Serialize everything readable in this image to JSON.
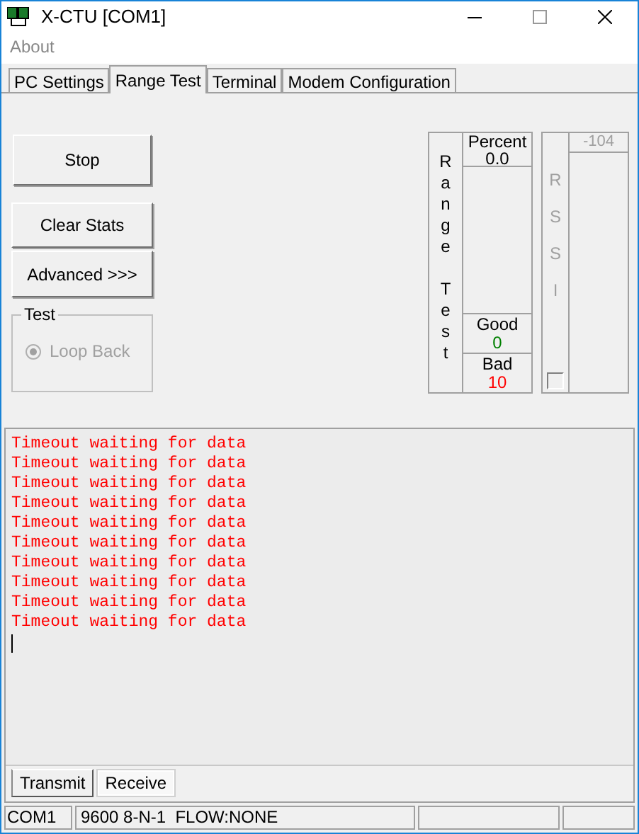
{
  "window": {
    "title": "X-CTU  [COM1]"
  },
  "menu": [
    "About"
  ],
  "tabs": [
    {
      "label": "PC Settings",
      "selected": false
    },
    {
      "label": "Range Test",
      "selected": true
    },
    {
      "label": "Terminal",
      "selected": false
    },
    {
      "label": "Modem Configuration",
      "selected": false
    }
  ],
  "buttons": [
    "Stop",
    "Clear Stats",
    "Advanced >>>"
  ],
  "test_group": {
    "title": "Test",
    "option": {
      "label": "Loop Back",
      "checked": true,
      "disabled": true
    }
  },
  "range_panel": {
    "label": "Range Test",
    "percent_label": "Percent",
    "percent": "0.0",
    "good_label": "Good",
    "good": "0",
    "bad_label": "Bad",
    "bad": "10"
  },
  "rssi_panel": {
    "label": "RSSI",
    "disabled": true,
    "value": "-104",
    "checked": false
  },
  "log": [
    "Timeout waiting for data",
    "Timeout waiting for data",
    "Timeout waiting for data",
    "Timeout waiting for data",
    "Timeout waiting for data",
    "Timeout waiting for data",
    "Timeout waiting for data",
    "Timeout waiting for data",
    "Timeout waiting for data",
    "Timeout waiting for data"
  ],
  "bottom_tabs": [
    {
      "label": "Transmit",
      "selected": false
    },
    {
      "label": "Receive",
      "selected": true
    }
  ],
  "status_bar": [
    "COM1",
    "9600 8-N-1  FLOW:NONE"
  ]
}
